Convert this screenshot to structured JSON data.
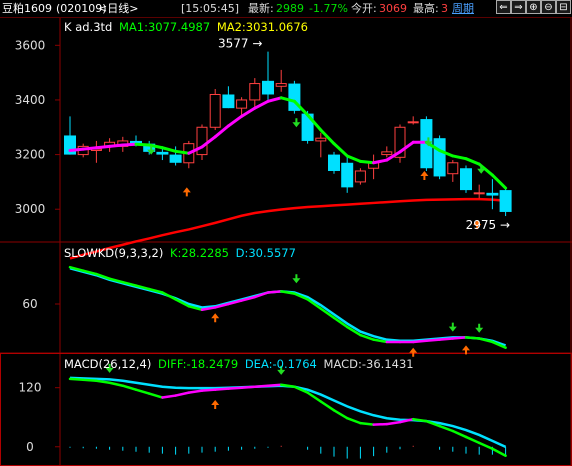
{
  "topbar": {
    "symbol": "豆粕1609",
    "code": "(020109)",
    "period": "<日线>",
    "time": "[15:05:45]",
    "latest_label": "最新:",
    "latest_value": "2989",
    "change": "-1.77%",
    "open_label": "今开:",
    "open_value": "3069",
    "high_label": "最高:",
    "high_value": "3",
    "weekly_label": "周期",
    "buttons": [
      "⇐",
      "⇒",
      "⊕",
      "⊖",
      "⊟"
    ]
  },
  "main_panel": {
    "label": "K  ad.3td",
    "ma1": "MA1:3077.4987",
    "ma2": "MA2:3031.0676",
    "high_annotation": "3577",
    "low_annotation": "2975"
  },
  "kd_panel": {
    "label": "SLOWKD(9,3,3,2)",
    "k": "K:28.2285",
    "d": "D:30.5577"
  },
  "macd_panel": {
    "label": "MACD(26,12,4)",
    "diff": "DIFF:-18.2479",
    "dea": "DEA:-0.1764",
    "macd": "MACD:-36.1431"
  },
  "colors": {
    "up": "#ff4040",
    "down": "#00e0ff",
    "ma1_green": "#00ff00",
    "ma1_magenta": "#ff00ff",
    "ma2": "#ff0000",
    "axis": "#8b0000",
    "label_yellow": "#ffff00"
  },
  "chart_data": [
    {
      "type": "candlestick",
      "ylim": [
        2880,
        3700
      ],
      "yticks": [
        3000,
        3200,
        3400,
        3600
      ],
      "candles": [
        {
          "o": 3270,
          "h": 3340,
          "l": 3200,
          "c": 3200
        },
        {
          "o": 3200,
          "h": 3240,
          "l": 3190,
          "c": 3230
        },
        {
          "o": 3215,
          "h": 3250,
          "l": 3170,
          "c": 3220
        },
        {
          "o": 3230,
          "h": 3260,
          "l": 3210,
          "c": 3245
        },
        {
          "o": 3230,
          "h": 3265,
          "l": 3210,
          "c": 3250
        },
        {
          "o": 3250,
          "h": 3270,
          "l": 3230,
          "c": 3240
        },
        {
          "o": 3240,
          "h": 3250,
          "l": 3200,
          "c": 3210
        },
        {
          "o": 3210,
          "h": 3230,
          "l": 3180,
          "c": 3200
        },
        {
          "o": 3200,
          "h": 3230,
          "l": 3160,
          "c": 3170
        },
        {
          "o": 3170,
          "h": 3250,
          "l": 3150,
          "c": 3240
        },
        {
          "o": 3200,
          "h": 3310,
          "l": 3180,
          "c": 3300
        },
        {
          "o": 3300,
          "h": 3440,
          "l": 3290,
          "c": 3420
        },
        {
          "o": 3420,
          "h": 3450,
          "l": 3370,
          "c": 3370
        },
        {
          "o": 3370,
          "h": 3410,
          "l": 3340,
          "c": 3400
        },
        {
          "o": 3400,
          "h": 3480,
          "l": 3370,
          "c": 3460
        },
        {
          "o": 3470,
          "h": 3577,
          "l": 3400,
          "c": 3420
        },
        {
          "o": 3450,
          "h": 3510,
          "l": 3430,
          "c": 3460
        },
        {
          "o": 3460,
          "h": 3470,
          "l": 3350,
          "c": 3360
        },
        {
          "o": 3350,
          "h": 3360,
          "l": 3240,
          "c": 3250
        },
        {
          "o": 3250,
          "h": 3280,
          "l": 3190,
          "c": 3260
        },
        {
          "o": 3200,
          "h": 3210,
          "l": 3130,
          "c": 3140
        },
        {
          "o": 3170,
          "h": 3200,
          "l": 3060,
          "c": 3080
        },
        {
          "o": 3100,
          "h": 3150,
          "l": 3090,
          "c": 3140
        },
        {
          "o": 3150,
          "h": 3200,
          "l": 3110,
          "c": 3170
        },
        {
          "o": 3200,
          "h": 3230,
          "l": 3190,
          "c": 3210
        },
        {
          "o": 3190,
          "h": 3310,
          "l": 3170,
          "c": 3300
        },
        {
          "o": 3320,
          "h": 3340,
          "l": 3310,
          "c": 3320
        },
        {
          "o": 3330,
          "h": 3340,
          "l": 3140,
          "c": 3150
        },
        {
          "o": 3260,
          "h": 3270,
          "l": 3110,
          "c": 3120
        },
        {
          "o": 3130,
          "h": 3180,
          "l": 3100,
          "c": 3170
        },
        {
          "o": 3150,
          "h": 3160,
          "l": 3060,
          "c": 3070
        },
        {
          "o": 3060,
          "h": 3090,
          "l": 3040,
          "c": 3060
        },
        {
          "o": 3060,
          "h": 3110,
          "l": 3000,
          "c": 3050
        },
        {
          "o": 3070,
          "h": 3080,
          "l": 2975,
          "c": 2990
        }
      ],
      "ma1": [
        3215,
        3220,
        3225,
        3230,
        3235,
        3238,
        3235,
        3225,
        3212,
        3205,
        3228,
        3265,
        3305,
        3340,
        3370,
        3395,
        3408,
        3395,
        3345,
        3290,
        3240,
        3195,
        3175,
        3170,
        3180,
        3210,
        3245,
        3245,
        3215,
        3195,
        3185,
        3165,
        3125,
        3077.4987
      ],
      "ma2": [
        2820,
        2833,
        2845,
        2858,
        2870,
        2882,
        2893,
        2905,
        2916,
        2926,
        2938,
        2950,
        2963,
        2976,
        2986,
        2993,
        2999,
        3004,
        3008,
        3011,
        3014,
        3017,
        3020,
        3023,
        3026,
        3029,
        3032,
        3034,
        3035,
        3036,
        3037,
        3037,
        3035,
        3031.0676
      ]
    },
    {
      "type": "line",
      "ylim": [
        20,
        100
      ],
      "yticks": [
        60
      ],
      "series": [
        {
          "name": "K",
          "values": [
            92,
            89,
            86,
            82,
            79,
            76,
            73,
            70,
            64,
            58,
            55,
            57,
            60,
            63,
            66,
            70,
            71,
            69,
            64,
            56,
            48,
            40,
            33,
            29,
            27,
            27,
            27,
            28,
            29,
            30,
            31,
            30,
            27,
            22
          ]
        },
        {
          "name": "D",
          "values": [
            91,
            88,
            85,
            81,
            78,
            75,
            72,
            69,
            65,
            60,
            57,
            58,
            61,
            64,
            67,
            70,
            71,
            70,
            66,
            59,
            51,
            43,
            36,
            32,
            29,
            28,
            28,
            29,
            30,
            31,
            31,
            30,
            28,
            24
          ]
        }
      ]
    },
    {
      "type": "line",
      "ylim": [
        -35,
        160
      ],
      "yticks": [
        0,
        120
      ],
      "series": [
        {
          "name": "DIFF",
          "values": [
            138,
            136,
            134,
            130,
            124,
            116,
            108,
            100,
            104,
            110,
            114,
            116,
            118,
            120,
            122,
            124,
            126,
            122,
            110,
            92,
            74,
            58,
            48,
            45,
            46,
            50,
            56,
            52,
            42,
            32,
            20,
            8,
            -4,
            -18.2479
          ]
        },
        {
          "name": "DEA",
          "values": [
            140,
            139,
            138,
            137,
            134,
            130,
            126,
            122,
            120,
            119,
            119,
            119,
            120,
            121,
            122,
            123,
            124,
            122,
            116,
            106,
            94,
            82,
            72,
            64,
            58,
            55,
            54,
            52,
            48,
            42,
            34,
            24,
            12,
            -0.1764
          ]
        }
      ],
      "histogram": [
        -2,
        -3,
        -4,
        -6,
        -8,
        -10,
        -12,
        -14,
        -16,
        -14,
        -12,
        -10,
        -8,
        -6,
        -4,
        -2,
        2,
        0,
        -6,
        -14,
        -20,
        -24,
        -24,
        -19,
        -12,
        -5,
        2,
        0,
        -6,
        -10,
        -14,
        -16,
        -16,
        -18
      ]
    }
  ]
}
